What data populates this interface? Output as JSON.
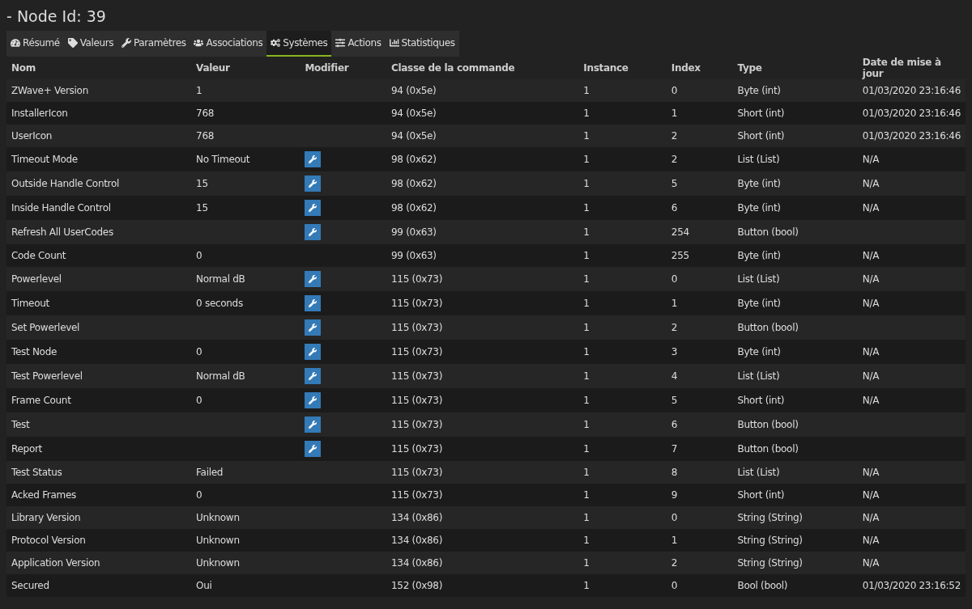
{
  "title": "- Node Id: 39",
  "tabs": [
    {
      "label": "Résumé",
      "selected": false
    },
    {
      "label": "Valeurs",
      "selected": false
    },
    {
      "label": "Paramètres",
      "selected": false
    },
    {
      "label": "Associations",
      "selected": false
    },
    {
      "label": "Systèmes",
      "selected": true
    },
    {
      "label": "Actions",
      "selected": false
    },
    {
      "label": "Statistiques",
      "selected": false
    }
  ],
  "table": {
    "columns": [
      "Nom",
      "Valeur",
      "Modifier",
      "Classe de la commande",
      "Instance",
      "Index",
      "Type",
      "Date de mise à jour"
    ],
    "rows": [
      {
        "name": "ZWave+ Version",
        "value": "1",
        "editable": false,
        "class": "94 (0x5e)",
        "instance": "1",
        "index": "0",
        "type": "Byte (int)",
        "date": "01/03/2020 23:16:46"
      },
      {
        "name": "InstallerIcon",
        "value": "768",
        "editable": false,
        "class": "94 (0x5e)",
        "instance": "1",
        "index": "1",
        "type": "Short (int)",
        "date": "01/03/2020 23:16:46"
      },
      {
        "name": "UserIcon",
        "value": "768",
        "editable": false,
        "class": "94 (0x5e)",
        "instance": "1",
        "index": "2",
        "type": "Short (int)",
        "date": "01/03/2020 23:16:46"
      },
      {
        "name": "Timeout Mode",
        "value": "No Timeout",
        "editable": true,
        "class": "98 (0x62)",
        "instance": "1",
        "index": "2",
        "type": "List (List)",
        "date": "N/A"
      },
      {
        "name": "Outside Handle Control",
        "value": "15",
        "editable": true,
        "class": "98 (0x62)",
        "instance": "1",
        "index": "5",
        "type": "Byte (int)",
        "date": "N/A"
      },
      {
        "name": "Inside Handle Control",
        "value": "15",
        "editable": true,
        "class": "98 (0x62)",
        "instance": "1",
        "index": "6",
        "type": "Byte (int)",
        "date": "N/A"
      },
      {
        "name": "Refresh All UserCodes",
        "editable": true,
        "class": "99 (0x63)",
        "instance": "1",
        "index": "254",
        "type": "Button (bool)"
      },
      {
        "name": "Code Count",
        "value": "0",
        "editable": false,
        "class": "99 (0x63)",
        "instance": "1",
        "index": "255",
        "type": "Byte (int)",
        "date": "N/A"
      },
      {
        "name": "Powerlevel",
        "value": "Normal dB",
        "editable": true,
        "class": "115 (0x73)",
        "instance": "1",
        "index": "0",
        "type": "List (List)",
        "date": "N/A"
      },
      {
        "name": "Timeout",
        "value": "0 seconds",
        "editable": true,
        "class": "115 (0x73)",
        "instance": "1",
        "index": "1",
        "type": "Byte (int)",
        "date": "N/A"
      },
      {
        "name": "Set Powerlevel",
        "editable": true,
        "class": "115 (0x73)",
        "instance": "1",
        "index": "2",
        "type": "Button (bool)"
      },
      {
        "name": "Test Node",
        "value": "0",
        "editable": true,
        "class": "115 (0x73)",
        "instance": "1",
        "index": "3",
        "type": "Byte (int)",
        "date": "N/A"
      },
      {
        "name": "Test Powerlevel",
        "value": "Normal dB",
        "editable": true,
        "class": "115 (0x73)",
        "instance": "1",
        "index": "4",
        "type": "List (List)",
        "date": "N/A"
      },
      {
        "name": "Frame Count",
        "value": "0",
        "editable": true,
        "class": "115 (0x73)",
        "instance": "1",
        "index": "5",
        "type": "Short (int)",
        "date": "N/A"
      },
      {
        "name": "Test",
        "editable": true,
        "class": "115 (0x73)",
        "instance": "1",
        "index": "6",
        "type": "Button (bool)"
      },
      {
        "name": "Report",
        "editable": true,
        "class": "115 (0x73)",
        "instance": "1",
        "index": "7",
        "type": "Button (bool)"
      },
      {
        "name": "Test Status",
        "value": "Failed",
        "editable": false,
        "class": "115 (0x73)",
        "instance": "1",
        "index": "8",
        "type": "List (List)",
        "date": "N/A"
      },
      {
        "name": "Acked Frames",
        "value": "0",
        "editable": false,
        "class": "115 (0x73)",
        "instance": "1",
        "index": "9",
        "type": "Short (int)",
        "date": "N/A"
      },
      {
        "name": "Library Version",
        "value": "Unknown",
        "editable": false,
        "class": "134 (0x86)",
        "instance": "1",
        "index": "0",
        "type": "String (String)",
        "date": "N/A"
      },
      {
        "name": "Protocol Version",
        "value": "Unknown",
        "editable": false,
        "class": "134 (0x86)",
        "instance": "1",
        "index": "1",
        "type": "String (String)",
        "date": "N/A"
      },
      {
        "name": "Application Version",
        "value": "Unknown",
        "editable": false,
        "class": "134 (0x86)",
        "instance": "1",
        "index": "2",
        "type": "String (String)",
        "date": "N/A"
      },
      {
        "name": "Secured",
        "value": "Oui",
        "editable": false,
        "class": "152 (0x98)",
        "instance": "1",
        "index": "0",
        "type": "Bool (bool)",
        "date": "01/03/2020 23:16:52"
      }
    ]
  }
}
